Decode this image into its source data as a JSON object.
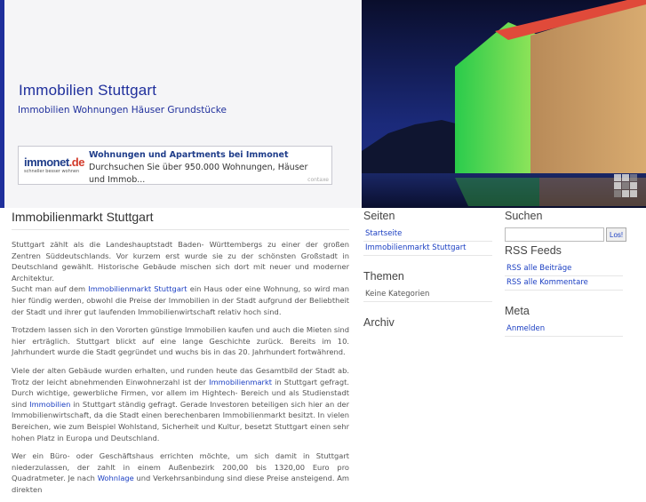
{
  "header": {
    "title": "Immobilien Stuttgart",
    "subtitle": "Immobilien Wohnungen Häuser Grundstücke"
  },
  "ad": {
    "logo_main": "immonet",
    "logo_suffix": ".de",
    "logo_tagline": "schneller besser wohnen",
    "title": "Wohnungen und Apartments bei Immonet",
    "text": "Durchsuchen Sie über 950.000 Wohnungen, Häuser und Immob...",
    "credit": "contaxe"
  },
  "main": {
    "heading": "Immobilienmarkt Stuttgart",
    "p1a": "Stuttgart zählt als die Landeshauptstadt Baden- Württembergs zu einer der großen Zentren Süddeutschlands. Vor kurzem erst wurde sie zu der schönsten Großstadt in Deutschland gewählt. Historische Gebäude mischen sich dort mit neuer und moderner Architektur.",
    "p1b_pre": "Sucht man auf dem ",
    "p1b_link": "Immobilienmarkt Stuttgart",
    "p1b_post": " ein Haus oder eine Wohnung, so wird man hier fündig werden, obwohl die Preise der Immobilien in der Stadt aufgrund der Beliebtheit der Stadt und ihrer gut laufenden Immobilienwirtschaft relativ hoch sind.",
    "p2": "Trotzdem lassen sich in den Vororten günstige Immobilien kaufen und auch die Mieten sind hier erträglich. Stuttgart blickt auf eine lange Geschichte zurück. Bereits im 10. Jahrhundert wurde die Stadt gegründet und wuchs bis in das 20. Jahrhundert fortwährend.",
    "p3_pre": "Viele der alten Gebäude wurden erhalten, und runden heute das Gesamtbild der Stadt ab. Trotz der leicht abnehmenden Einwohnerzahl ist der ",
    "p3_link1": "Immobilienmarkt",
    "p3_mid": " in Stuttgart gefragt. Durch wichtige, gewerbliche Firmen, vor allem im Hightech- Bereich und als Studienstadt sind ",
    "p3_link2": "Immobilien",
    "p3_post": " in Stuttgart ständig gefragt. Gerade Investoren beteiligen sich hier an der Immobilienwirtschaft, da die Stadt einen berechenbaren Immobilienmarkt besitzt. In vielen Bereichen, wie zum Beispiel Wohlstand, Sicherheit und Kultur, besetzt Stuttgart einen sehr hohen Platz in Europa und Deutschland.",
    "p4_pre": "Wer ein Büro- oder Geschäftshaus errichten möchte, um sich damit in Stuttgart niederzulassen, der zahlt in einem Außenbezirk 200,00 bis 1320,00 Euro pro Quadratmeter. Je nach ",
    "p4_link": "Wohnlage",
    "p4_post": " und Verkehrsanbindung sind diese Preise ansteigend. Am direkten"
  },
  "sidebar1": {
    "pages_heading": "Seiten",
    "pages": [
      "Startseite",
      "Immobilienmarkt Stuttgart"
    ],
    "themes_heading": "Themen",
    "themes_empty": "Keine Kategorien",
    "archive_heading": "Archiv"
  },
  "sidebar2": {
    "search_heading": "Suchen",
    "search_value": "",
    "search_button": "Los!",
    "rss_heading": "RSS Feeds",
    "rss": [
      "RSS alle Beiträge",
      "RSS alle Kommentare"
    ],
    "meta_heading": "Meta",
    "meta": [
      "Anmelden"
    ]
  },
  "colors": {
    "brand_blue": "#1f2f9c",
    "link": "#1a3ec2"
  }
}
